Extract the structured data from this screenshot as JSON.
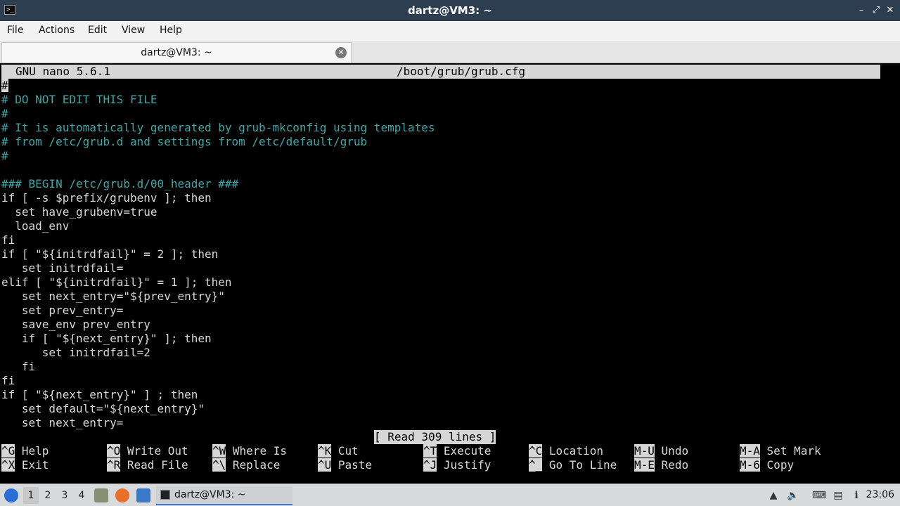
{
  "window": {
    "title": "dartz@VM3: ~",
    "controls": {
      "minimize": "–",
      "maximize": "⤢",
      "close": "✕"
    }
  },
  "menu": [
    "File",
    "Actions",
    "Edit",
    "View",
    "Help"
  ],
  "tab": {
    "label": "dartz@VM3: ~"
  },
  "nano": {
    "version": "GNU nano 5.6.1",
    "filename": "/boot/grub/grub.cfg",
    "status": "[ Read 309 lines ]",
    "lines": [
      {
        "text": "#",
        "type": "comment"
      },
      {
        "text": "# DO NOT EDIT THIS FILE",
        "type": "comment"
      },
      {
        "text": "#",
        "type": "comment"
      },
      {
        "text": "# It is automatically generated by grub-mkconfig using templates",
        "type": "comment"
      },
      {
        "text": "# from /etc/grub.d and settings from /etc/default/grub",
        "type": "comment"
      },
      {
        "text": "#",
        "type": "comment"
      },
      {
        "text": "",
        "type": "code"
      },
      {
        "text": "### BEGIN /etc/grub.d/00_header ###",
        "type": "comment"
      },
      {
        "text": "if [ -s $prefix/grubenv ]; then",
        "type": "code"
      },
      {
        "text": "  set have_grubenv=true",
        "type": "code"
      },
      {
        "text": "  load_env",
        "type": "code"
      },
      {
        "text": "fi",
        "type": "code"
      },
      {
        "text": "if [ \"${initrdfail}\" = 2 ]; then",
        "type": "code"
      },
      {
        "text": "   set initrdfail=",
        "type": "code"
      },
      {
        "text": "elif [ \"${initrdfail}\" = 1 ]; then",
        "type": "code"
      },
      {
        "text": "   set next_entry=\"${prev_entry}\"",
        "type": "code"
      },
      {
        "text": "   set prev_entry=",
        "type": "code"
      },
      {
        "text": "   save_env prev_entry",
        "type": "code"
      },
      {
        "text": "   if [ \"${next_entry}\" ]; then",
        "type": "code"
      },
      {
        "text": "      set initrdfail=2",
        "type": "code"
      },
      {
        "text": "   fi",
        "type": "code"
      },
      {
        "text": "fi",
        "type": "code"
      },
      {
        "text": "if [ \"${next_entry}\" ] ; then",
        "type": "code"
      },
      {
        "text": "   set default=\"${next_entry}\"",
        "type": "code"
      },
      {
        "text": "   set next_entry=",
        "type": "code"
      }
    ],
    "shortcuts": [
      {
        "key": "^G",
        "label": "Help"
      },
      {
        "key": "^O",
        "label": "Write Out"
      },
      {
        "key": "^W",
        "label": "Where Is"
      },
      {
        "key": "^K",
        "label": "Cut"
      },
      {
        "key": "^T",
        "label": "Execute"
      },
      {
        "key": "^C",
        "label": "Location"
      },
      {
        "key": "M-U",
        "label": "Undo"
      },
      {
        "key": "M-A",
        "label": "Set Mark"
      },
      {
        "key": "^X",
        "label": "Exit"
      },
      {
        "key": "^R",
        "label": "Read File"
      },
      {
        "key": "^\\",
        "label": "Replace"
      },
      {
        "key": "^U",
        "label": "Paste"
      },
      {
        "key": "^J",
        "label": "Justify"
      },
      {
        "key": "^_",
        "label": "Go To Line"
      },
      {
        "key": "M-E",
        "label": "Redo"
      },
      {
        "key": "M-6",
        "label": "Copy"
      }
    ]
  },
  "taskbar": {
    "workspaces": [
      "1",
      "2",
      "3",
      "4"
    ],
    "active_workspace": "1",
    "task_label": "dartz@VM3: ~",
    "clock": "23:06"
  }
}
